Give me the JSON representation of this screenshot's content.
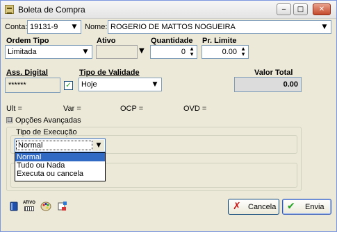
{
  "window": {
    "title": "Boleta de Compra",
    "controls": {
      "minimize": "‒",
      "maximize": "□",
      "close": "✕"
    }
  },
  "account": {
    "label": "Conta:",
    "value": "19131-9",
    "name_label": "Nome:",
    "name_value": "ROGERIO DE MATTOS NOGUEIRA"
  },
  "order": {
    "type_label": "Ordem Tipo",
    "type_value": "Limitada",
    "asset_label": "Ativo",
    "asset_value": "",
    "qty_label": "Quantidade",
    "qty_value": "0",
    "price_label": "Pr. Limite",
    "price_value": "0.00"
  },
  "signature": {
    "label": "Ass. Digital",
    "value": "******",
    "checked": true
  },
  "validity": {
    "label": "Tipo de Validade",
    "value": "Hoje"
  },
  "total": {
    "label": "Valor Total",
    "value": "0.00"
  },
  "quotes": {
    "ult": "Ult =",
    "var": "Var =",
    "ocp": "OCP =",
    "ovd": "OVD ="
  },
  "advanced": {
    "toggle": "⊟",
    "label": "Opções Avançadas",
    "exec_label": "Tipo de Execução",
    "exec_value": "Normal",
    "exec_options": [
      "Normal",
      "Tudo ou Nada",
      "Executa ou cancela"
    ]
  },
  "buttons": {
    "cancel": "Cancela",
    "cancel_icon": "✗",
    "send": "Envia",
    "send_icon": "✔"
  },
  "toolbar": {
    "book_icon": "book-icon",
    "ativo_label": "ATIVO",
    "palette_icon": "palette-icon",
    "edit_icon": "edit-icon"
  },
  "colors": {
    "accent": "#316ac5",
    "window_bg": "#ece9d8",
    "cancel_icon": "#cc1010",
    "send_icon": "#21a121"
  }
}
